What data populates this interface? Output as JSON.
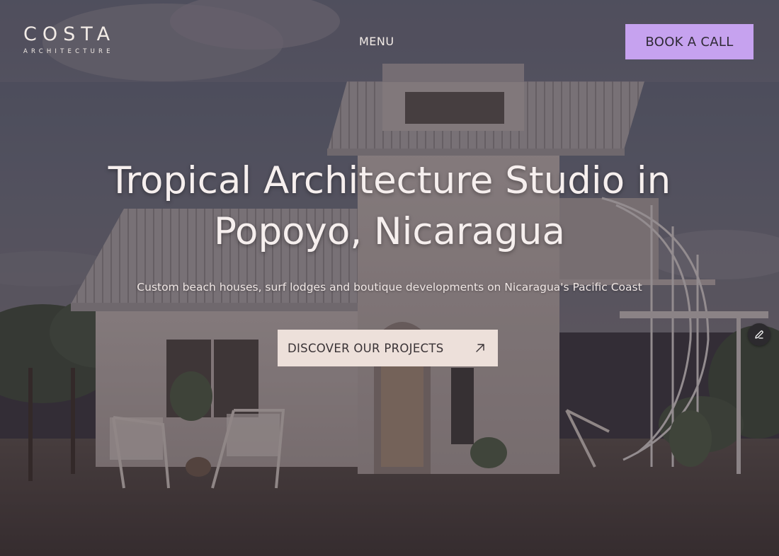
{
  "header": {
    "logo_main": "COSTA",
    "logo_sub": "ARCHITECTURE",
    "menu_label": "MENU",
    "book_label": "BOOK A CALL"
  },
  "hero": {
    "title": "Tropical Architecture Studio in Popoyo, Nicaragua",
    "subtitle": "Custom beach houses, surf lodges and boutique developments on Nicaragua's Pacific Coast",
    "cta_label": "DISCOVER OUR PROJECTS"
  },
  "icons": {
    "cta_icon": "arrow-up-right-icon",
    "fab_icon": "pencil-edit-icon"
  },
  "colors": {
    "book_button": "#c6a2ef",
    "cta_button": "#ede0da",
    "text_light": "#f6efee"
  }
}
